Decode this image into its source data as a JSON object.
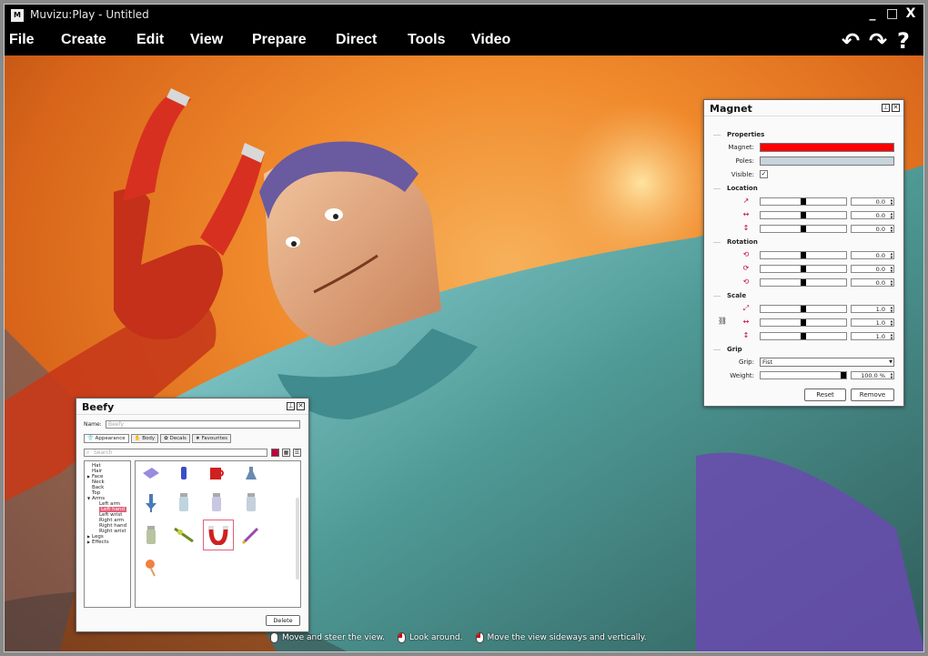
{
  "window": {
    "title": "Muvizu:Play - Untitled",
    "logo": "M",
    "controls": [
      "_",
      "□",
      "X"
    ]
  },
  "menu": [
    "File",
    "Create",
    "Edit",
    "View",
    "Prepare",
    "Direct",
    "Tools",
    "Video"
  ],
  "toolbar": {
    "undo": "↶",
    "redo": "↷",
    "help": "?"
  },
  "magnet_panel": {
    "title": "Magnet",
    "sections": {
      "properties": "Properties",
      "location": "Location",
      "rotation": "Rotation",
      "scale": "Scale",
      "grip": "Grip"
    },
    "labels": {
      "magnet": "Magnet:",
      "poles": "Poles:",
      "visible": "Visible:",
      "grip": "Grip:",
      "weight": "Weight:"
    },
    "magnet_color": "#ff0000",
    "poles_color": "#c8d4dc",
    "visible_checked": "✓",
    "location": [
      "0.0",
      "0.0",
      "0.0"
    ],
    "rotation": [
      "0.0",
      "0.0",
      "0.0"
    ],
    "scale": [
      "1.0",
      "1.0",
      "1.0"
    ],
    "grip_value": "Fist",
    "weight_value": "100.0 %",
    "weight_level": 1.0,
    "reset": "Reset",
    "remove": "Remove"
  },
  "beefy_panel": {
    "title": "Beefy",
    "name_label": "Name:",
    "name_value": "Beefy",
    "tabs": [
      "Appearance",
      "Body",
      "Decals",
      "Favourites"
    ],
    "search_placeholder": "Search",
    "tree": [
      "Hat",
      "Hair",
      "Face",
      "Neck",
      "Back",
      "Top",
      "Arms",
      "Left arm",
      "Left hand",
      "Left wrist",
      "Right arm",
      "Right hand",
      "Right wrist",
      "Legs",
      "Effects"
    ],
    "selected_tree_item": "Left hand",
    "delete": "Delete"
  },
  "hints": [
    "Move and steer the view.",
    "Look around.",
    "Move the view sideways and vertically."
  ],
  "colors": {
    "accent_red": "#ff0000",
    "selection_pink": "#e0607a",
    "menubar": "#000000"
  }
}
